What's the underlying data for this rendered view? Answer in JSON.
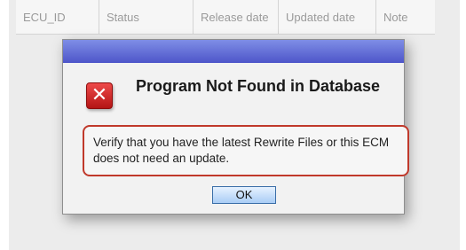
{
  "table": {
    "columns": [
      "ECU_ID",
      "Status",
      "Release date",
      "Updated date",
      "Note"
    ]
  },
  "dialog": {
    "title_bar_color": "#5a63d0",
    "error_icon_glyph": "✕",
    "title": "Program Not Found in Database",
    "message": "Verify that you have the latest Rewrite Files or this ECM does not need an update.",
    "ok_label": "OK",
    "accent_border_color": "#c0392b"
  }
}
